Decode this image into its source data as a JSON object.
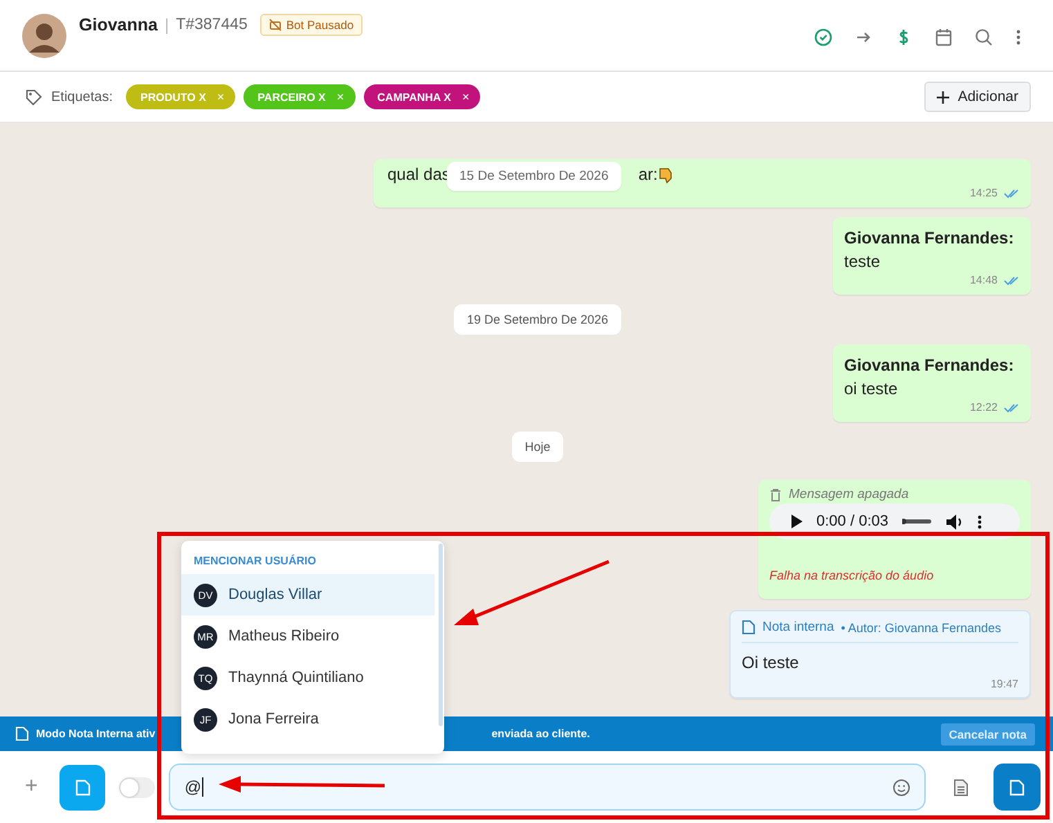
{
  "header": {
    "name": "Giovanna",
    "separator": "|",
    "ticket": "T#387445",
    "bot_badge": "Bot Pausado"
  },
  "tags": {
    "label": "Etiquetas:",
    "items": [
      {
        "label": "PRODUTO X",
        "remove": "×",
        "color": "#bfbd14"
      },
      {
        "label": "PARCEIRO X",
        "remove": "×",
        "color": "#52c41a"
      },
      {
        "label": "CAMPANHA X",
        "remove": "×",
        "color": "#c2127c"
      }
    ],
    "add_button": "Adicionar"
  },
  "sticky_date": "15 De Setembro De 2026",
  "messages": [
    {
      "kind": "partial",
      "text_before": "qual das",
      "text_after": "ar:",
      "time": "14:25",
      "read": true
    },
    {
      "kind": "text",
      "author": "Giovanna Fernandes:",
      "text": "teste",
      "time": "14:48",
      "read": true
    },
    {
      "kind": "date",
      "label": "19 De Setembro De 2026"
    },
    {
      "kind": "text",
      "author": "Giovanna Fernandes:",
      "text": "oi teste",
      "time": "12:22",
      "read": true
    },
    {
      "kind": "date",
      "label": "Hoje"
    },
    {
      "kind": "deleted_audio",
      "label": "Mensagem apagada",
      "audio_time": "0:00 / 0:03",
      "level": 0,
      "error": "Falha na transcrição do áudio"
    },
    {
      "kind": "note",
      "title": "Nota interna",
      "author": "• Autor: Giovanna Fernandes",
      "text": "Oi teste",
      "time": "19:47"
    }
  ],
  "banner": {
    "text_before": "Modo Nota Interna ativ",
    "text_after": "enviada ao cliente.",
    "cancel_button": "Cancelar nota"
  },
  "mention": {
    "title": "MENCIONAR USUÁRIO",
    "users": [
      {
        "initials": "DV",
        "name": "Douglas Villar",
        "selected": true
      },
      {
        "initials": "MR",
        "name": "Matheus Ribeiro",
        "selected": false
      },
      {
        "initials": "TQ",
        "name": "Thaynná Quintiliano",
        "selected": false
      },
      {
        "initials": "JF",
        "name": "Jona Ferreira",
        "selected": false
      }
    ]
  },
  "composer": {
    "plus": "+",
    "toggle_on": false,
    "value": "@"
  }
}
